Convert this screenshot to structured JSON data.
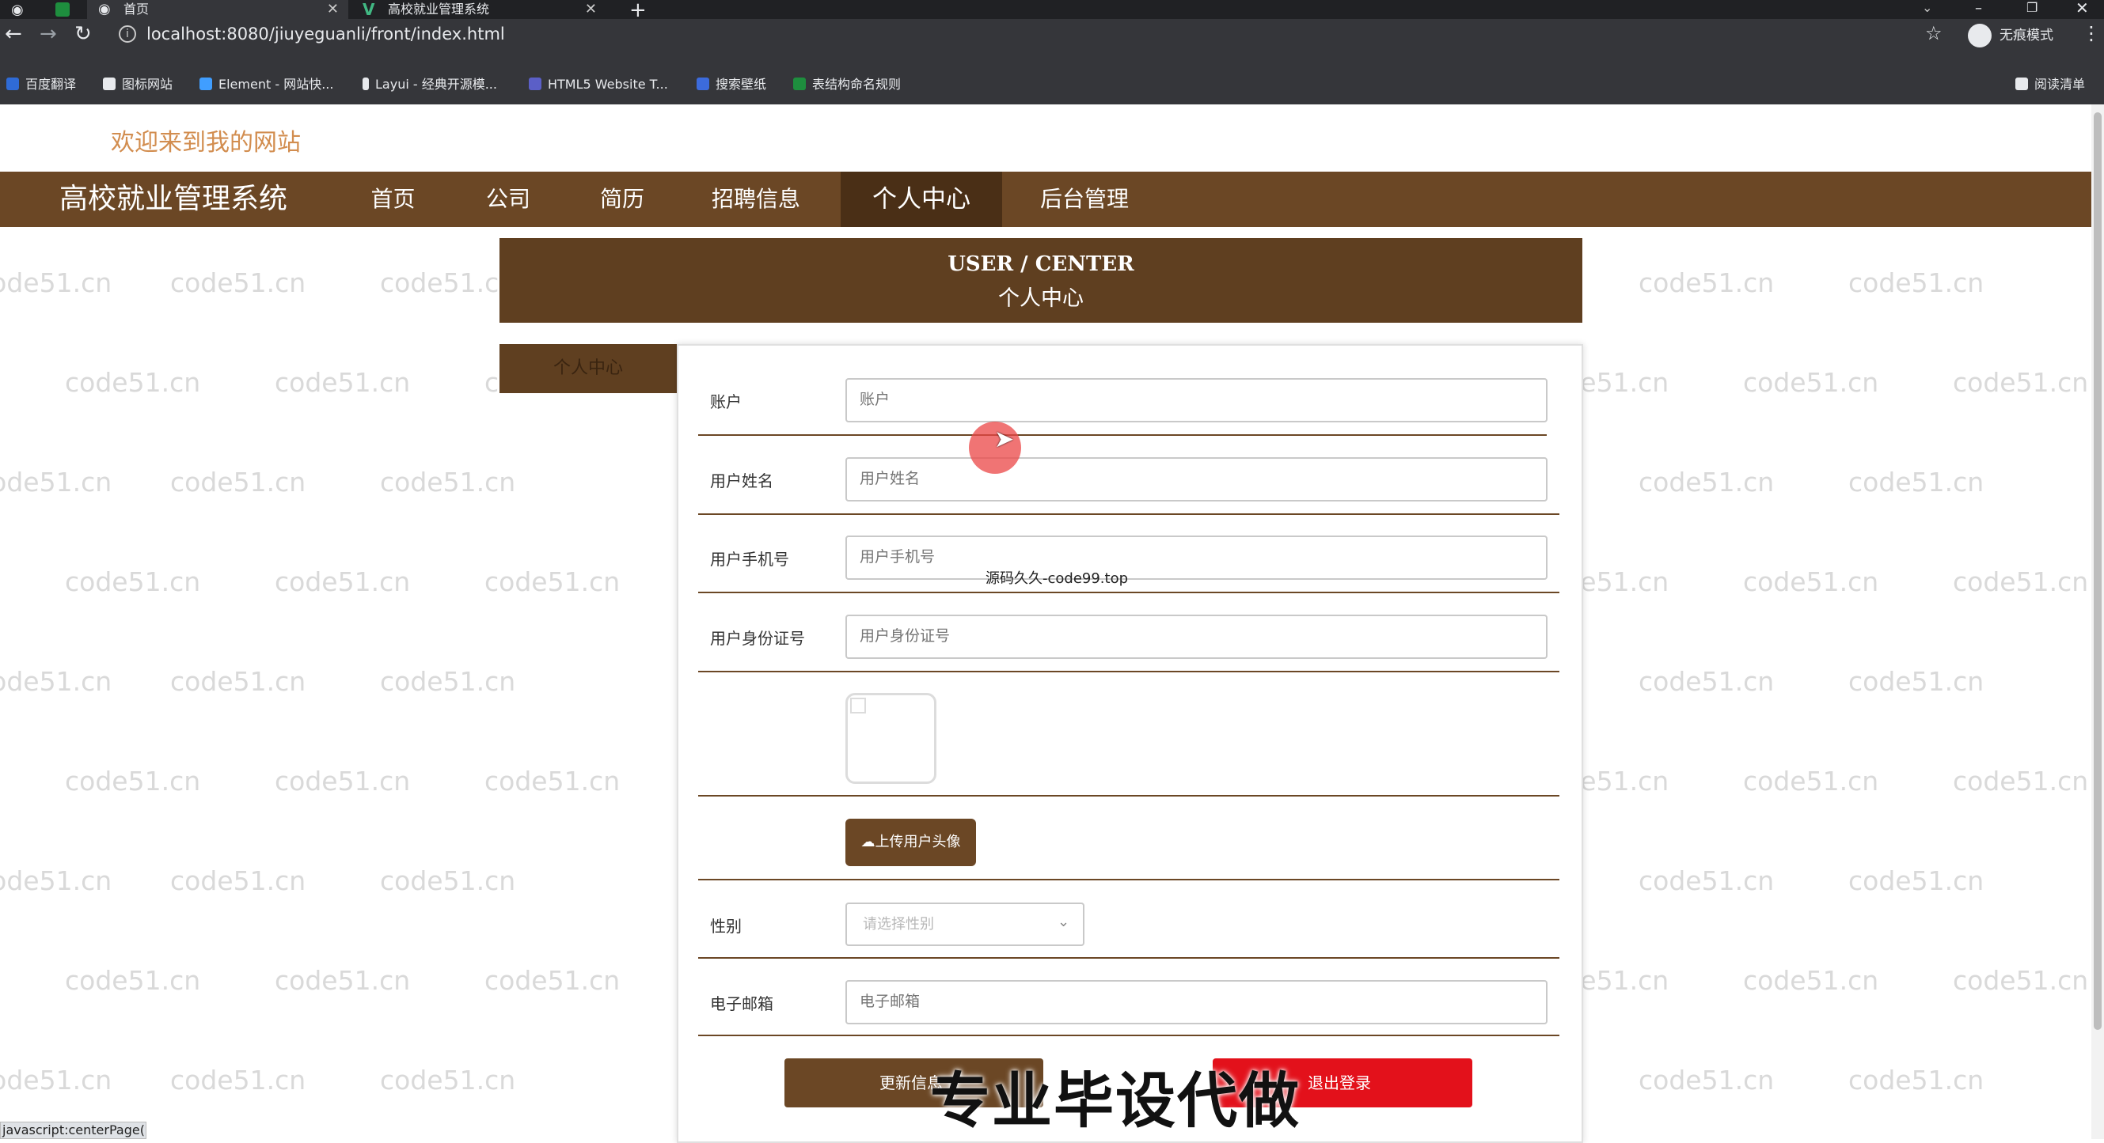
{
  "browser": {
    "tabs": [
      {
        "label": "首页",
        "active": true
      },
      {
        "label": "高校就业管理系统",
        "active": false
      }
    ],
    "new_tab": "+",
    "url": "localhost:8080/jiuyeguanli/front/index.html",
    "incognito_label": "无痕模式",
    "reading_list": "阅读清单",
    "bookmarks": [
      "百度翻译",
      "图标网站",
      "Element - 网站快...",
      "Layui - 经典开源模...",
      "HTML5 Website T...",
      "搜索壁纸",
      "表结构命名规则"
    ],
    "status_text": "javascript:centerPage();"
  },
  "site": {
    "welcome": "欢迎来到我的网站",
    "title": "高校就业管理系统",
    "nav": [
      "首页",
      "公司",
      "简历",
      "招聘信息",
      "个人中心",
      "后台管理"
    ]
  },
  "center": {
    "title_en": "USER / CENTER",
    "title_zh": "个人中心",
    "side_item": "个人中心"
  },
  "form": {
    "account": {
      "label": "账户",
      "placeholder": "账户"
    },
    "name": {
      "label": "用户姓名",
      "placeholder": "用户姓名"
    },
    "phone": {
      "label": "用户手机号",
      "placeholder": "用户手机号"
    },
    "idcard": {
      "label": "用户身份证号",
      "placeholder": "用户身份证号"
    },
    "upload_label": "上传用户头像",
    "gender": {
      "label": "性别",
      "placeholder": "请选择性别"
    },
    "email": {
      "label": "电子邮箱",
      "placeholder": "电子邮箱"
    },
    "update_label": "更新信息",
    "logout_label": "退出登录"
  },
  "overlays": {
    "big": "专业毕设代做",
    "small": "源码久久-code99.top",
    "watermark": "code51.cn"
  },
  "colors": {
    "brand": "#6b4725",
    "brand_dark": "#5f3f20",
    "danger": "#e3111b",
    "welcome": "#d28d4f"
  }
}
